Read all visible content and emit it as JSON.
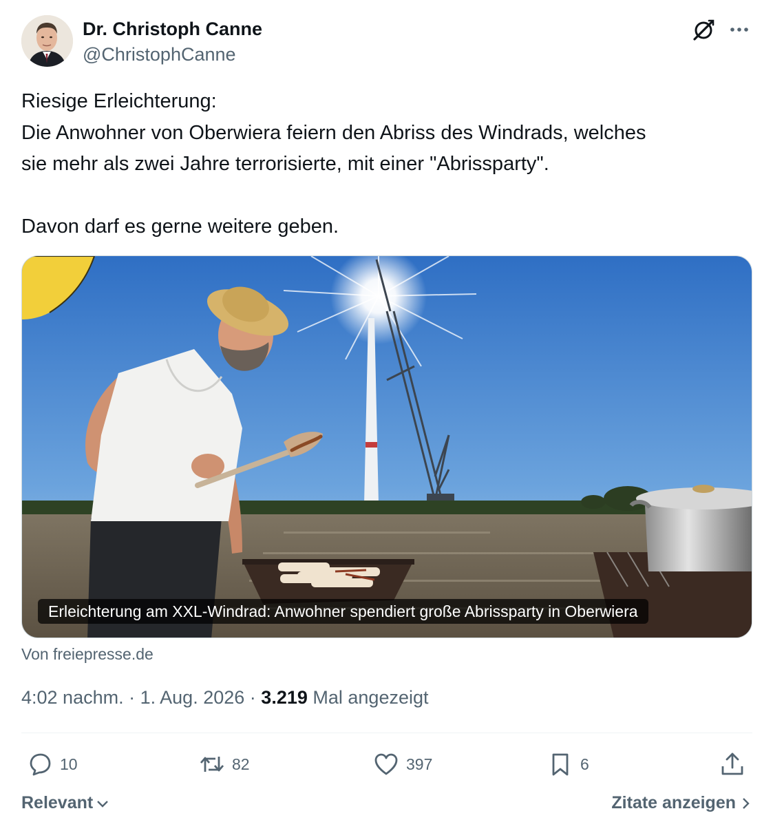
{
  "author": {
    "name": "Dr. Christoph Canne",
    "handle": "@ChristophCanne"
  },
  "tweet": {
    "lines": [
      "Riesige Erleichterung:",
      "Die Anwohner von Oberwiera feiern den Abriss des Windrads, welches",
      "sie mehr als zwei Jahre terrorisierte, mit einer \"Abrissparty\".",
      "Davon darf es gerne weitere geben."
    ]
  },
  "media": {
    "caption": "Erleichterung am XXL-Windrad: Anwohner spendiert große Abrissparty in Oberwiera",
    "source": "Von freiepresse.de"
  },
  "meta": {
    "time": "4:02 nachm.",
    "date": "1. Aug. 2026",
    "separator": "·",
    "views_count": "3.219",
    "views_label": "Mal angezeigt"
  },
  "actions": {
    "replies": "10",
    "reposts": "82",
    "likes": "397",
    "bookmarks": "6"
  },
  "footer": {
    "sort_label": "Relevant",
    "quotes_label": "Zitate anzeigen"
  },
  "colors": {
    "text_primary": "#0f1419",
    "text_secondary": "#536471",
    "divider": "#eff3f4",
    "card_border": "#cfd9de"
  }
}
